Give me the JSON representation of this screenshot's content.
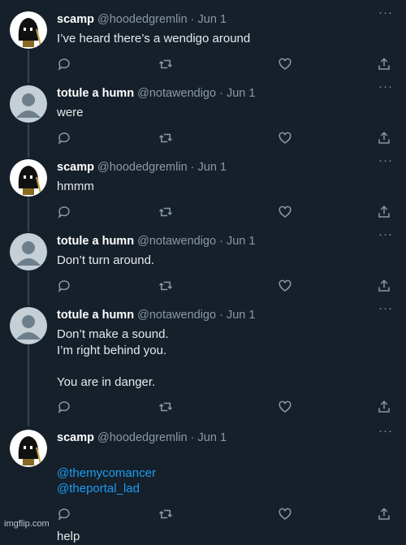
{
  "tweets": [
    {
      "avatar": "hooded-figure",
      "name": "scamp",
      "handle": "@hoodedgremlin",
      "sep": "·",
      "date": "Jun 1",
      "text": "I’ve heard there’s a wendigo around"
    },
    {
      "avatar": "default-person",
      "name": "totule a humn",
      "handle": "@notawendigo",
      "sep": "·",
      "date": "Jun 1",
      "text": "were"
    },
    {
      "avatar": "hooded-figure",
      "name": "scamp",
      "handle": "@hoodedgremlin",
      "sep": "·",
      "date": "Jun 1",
      "text": "hmmm"
    },
    {
      "avatar": "default-person",
      "name": "totule a humn",
      "handle": "@notawendigo",
      "sep": "·",
      "date": "Jun 1",
      "text": "Don’t turn around."
    },
    {
      "avatar": "default-person",
      "name": "totule a humn",
      "handle": "@notawendigo",
      "sep": "·",
      "date": "Jun 1",
      "text": "Don’t make a sound.\nI’m right behind you.\n\nYou are in danger."
    },
    {
      "avatar": "hooded-figure",
      "name": "scamp",
      "handle": "@hoodedgremlin",
      "sep": "·",
      "date": "Jun 1",
      "mention_1": "@themycomancer",
      "mention_2": "@theportal_lad",
      "text": "help"
    }
  ],
  "more_label": "···",
  "icons": [
    "reply-icon",
    "retweet-icon",
    "like-icon",
    "share-icon"
  ],
  "colors": {
    "background": "#15202b",
    "text": "#e7e9ea",
    "muted": "#8b98a5",
    "mention": "#1d9bf0",
    "thread_line": "#38444d"
  },
  "watermark": "imgflip.com"
}
